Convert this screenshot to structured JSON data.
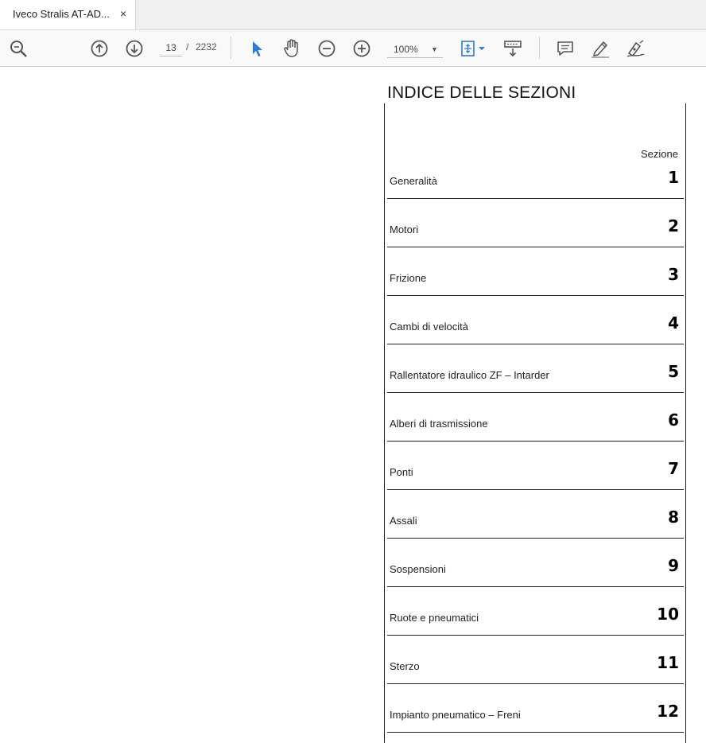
{
  "tab": {
    "title": "Iveco Stralis AT-AD...",
    "close": "×"
  },
  "toolbar": {
    "icons": [
      "zoom-search-icon",
      "page-up-icon",
      "page-down-icon",
      "select-pointer-icon",
      "hand-pan-icon",
      "zoom-out-icon",
      "zoom-in-icon",
      "fit-page-icon",
      "scroll-mode-icon",
      "comment-icon",
      "highlight-pen-icon",
      "sign-pen-icon"
    ],
    "current_page": "13",
    "page_separator": "/",
    "total_pages": "2232",
    "zoom": "100%",
    "accent_color": "#2b7bd8"
  },
  "document": {
    "title": "INDICE DELLE SEZIONI",
    "column_header": "Sezione",
    "rows": [
      {
        "label": "Generalità",
        "num": "1"
      },
      {
        "label": "Motori",
        "num": "2"
      },
      {
        "label": "Frizione",
        "num": "3"
      },
      {
        "label": "Cambi di velocità",
        "num": "4"
      },
      {
        "label": "Rallentatore idraulico ZF – Intarder",
        "num": "5"
      },
      {
        "label": "Alberi di trasmissione",
        "num": "6"
      },
      {
        "label": "Ponti",
        "num": "7"
      },
      {
        "label": "Assali",
        "num": "8"
      },
      {
        "label": "Sospensioni",
        "num": "9"
      },
      {
        "label": "Ruote e pneumatici",
        "num": "10"
      },
      {
        "label": "Sterzo",
        "num": "11"
      },
      {
        "label": "Impianto pneumatico – Freni",
        "num": "12"
      }
    ]
  }
}
